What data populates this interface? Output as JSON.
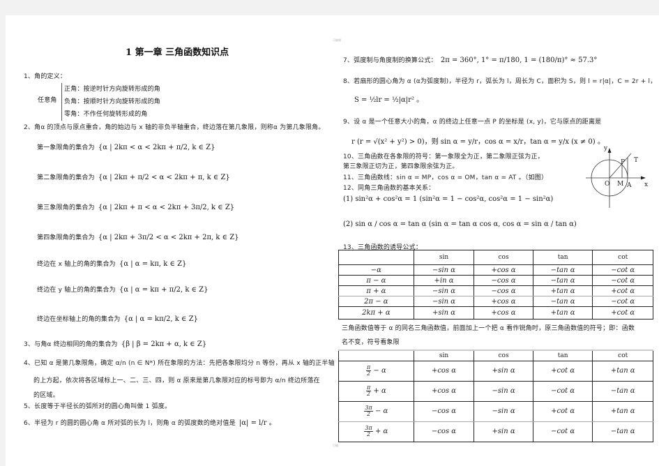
{
  "left": {
    "title": "1 第一章  三角函数知识点",
    "s1": {
      "heading": "1、角的定义：",
      "group_label": "任意角",
      "items": [
        "正角：按逆时针方向旋转形成的角",
        "负角：按顺时针方向旋转形成的角",
        "零角：不作任何旋转形成的角"
      ]
    },
    "s2": {
      "text": "2、角α 的顶点与原点重合，角的始边与 x 轴的非负半轴重合，终边落在第几象限，则称α 为第几象限角。",
      "sets": [
        {
          "label": "第一象限角的集合为",
          "formula": "{α | 2kπ < α < 2kπ + π/2, k ∈ Z}"
        },
        {
          "label": "第二象限角的集合为",
          "formula": "{α | 2kπ + π/2 < α < 2kπ + π, k ∈ Z}"
        },
        {
          "label": "第三象限角的集合为",
          "formula": "{α | 2kπ + π < α < 2kπ + 3π/2, k ∈ Z}"
        },
        {
          "label": "第四象限角的集合为",
          "formula": "{α | 2kπ + 3π/2 < α < 2kπ + 2π, k ∈ Z}"
        },
        {
          "label": "终边在 x 轴上的角的集合为",
          "formula": "{α | α = kπ, k ∈ Z}"
        },
        {
          "label": "终边在 y 轴上的角的集合为",
          "formula": "{α | α = kπ + π/2, k ∈ Z}"
        },
        {
          "label": "终边在坐标轴上的角的集合为",
          "formula": "{α | α = kπ/2, k ∈ Z}"
        }
      ]
    },
    "s3": {
      "label": "3、与角α 终边相同的角的集合为",
      "formula": "{β | β = 2kπ + α, k ∈ Z}"
    },
    "s4": {
      "line1": "4、已知 α 是第几象限角，确定 α/n (n ∈ N*) 所在象限的方法：先把各象限均分 n 等份，再从 x 轴的正半轴",
      "line2": "的上方起，依次将各区域标上一、二、三、四，则 α 原来是第几象限对应的标号即为 α/n 终边所落在",
      "line3": "的区域。"
    },
    "s5": "5、长度等于半径长的弧所对的圆心角叫做 1 弧度。",
    "s6": {
      "text": "6、半径为 r 的圆的圆心角 α 所对弧的长为 l，则角 α 的弧度数的绝对值是",
      "formula": "|α| = l/r 。"
    }
  },
  "right": {
    "s7": {
      "label": "7、弧度制与角度制的换算公式：",
      "formula": "2π = 360°, 1° = π/180, 1 = (180/π)° ≈ 57.3°"
    },
    "s8": {
      "line1": "8、若扇形的圆心角为 α (α为弧度制)，半径为 r，弧长为 l，周长为 C，面积为 S，则 l = r|α|，C = 2r + l，",
      "line2": "S = ½lr = ½|α|r² 。"
    },
    "s9": {
      "line1": "9、设 α 是一个任意大小的角，α 的终边上任意一点 P 的坐标是 (x, y)，它与原点的距离是",
      "line2": "r (r = √(x² + y²) > 0)，则 sin α = y/r，cos α = x/r，tan α = y/x (x ≠ 0) 。"
    },
    "s10": {
      "line1": "10、三角函数在各象限的符号：第一象限全为正，第二象限正弦为正，",
      "line2": "第三象限正切为正，第四象限余弦为正。"
    },
    "s11": "11、三角函数线：sin α = MP，cos α = OM，tan α = AT 。（如图）",
    "s12": {
      "heading": "12、同角三角函数的基本关系：",
      "f1": "(1) sin²α + cos²α = 1  (sin²α = 1 − cos²α, cos²α = 1 − sin²α)",
      "f2": "(2) sin α / cos α = tan α  (sin α = tan α cos α, cos α = sin α / tan α)"
    },
    "s13": {
      "heading": "13、三角函数的诱导公式：",
      "table1": {
        "headers": [
          "",
          "sin",
          "cos",
          "tan",
          "cot"
        ],
        "rows": [
          [
            "−α",
            "−sin α",
            "+cos α",
            "−tan α",
            "−cot α"
          ],
          [
            "π − α",
            "+in α",
            "−cos α",
            "−tan α",
            "−cot α"
          ],
          [
            "π + α",
            "−sin α",
            "−cos α",
            "+tan α",
            "+cot α"
          ],
          [
            "2π − α",
            "−sin α",
            "+cos α",
            "−tan α",
            "−cot α"
          ],
          [
            "2kπ + α",
            "+sin α",
            "+cos α",
            "+tan α",
            "+cot α"
          ]
        ]
      },
      "note_line1": "三角函数值等于 α 的同名三角函数值，前面加上一个把 α 看作锐角时，原三角函数值的符号；即：函数",
      "note_line2": "名不变，符号看象限",
      "table2": {
        "headers": [
          "",
          "sin",
          "cos",
          "tan",
          "cot"
        ],
        "rows": [
          [
            {
              "num": "π",
              "den": "2",
              "tail": "− α"
            },
            "+cos α",
            "+sin α",
            "+cot α",
            "+tan α"
          ],
          [
            {
              "num": "π",
              "den": "2",
              "tail": "+ α"
            },
            "+cos α",
            "−sin α",
            "−cot α",
            "−tan α"
          ],
          [
            {
              "num": "3π",
              "den": "2",
              "tail": "− α"
            },
            "−cos α",
            "−sin α",
            "+cot α",
            "+tan α"
          ],
          [
            {
              "num": "3π",
              "den": "2",
              "tail": "+ α"
            },
            "−cos α",
            "+sin α",
            "−cot α",
            "−tan α"
          ]
        ]
      }
    },
    "diagram": {
      "labels": {
        "y": "y",
        "x": "x",
        "O": "O",
        "M": "M",
        "A": "A",
        "P": "P",
        "T": "T"
      }
    }
  },
  "watermarks": {
    "top": "可编辑",
    "bottom": "可编"
  }
}
